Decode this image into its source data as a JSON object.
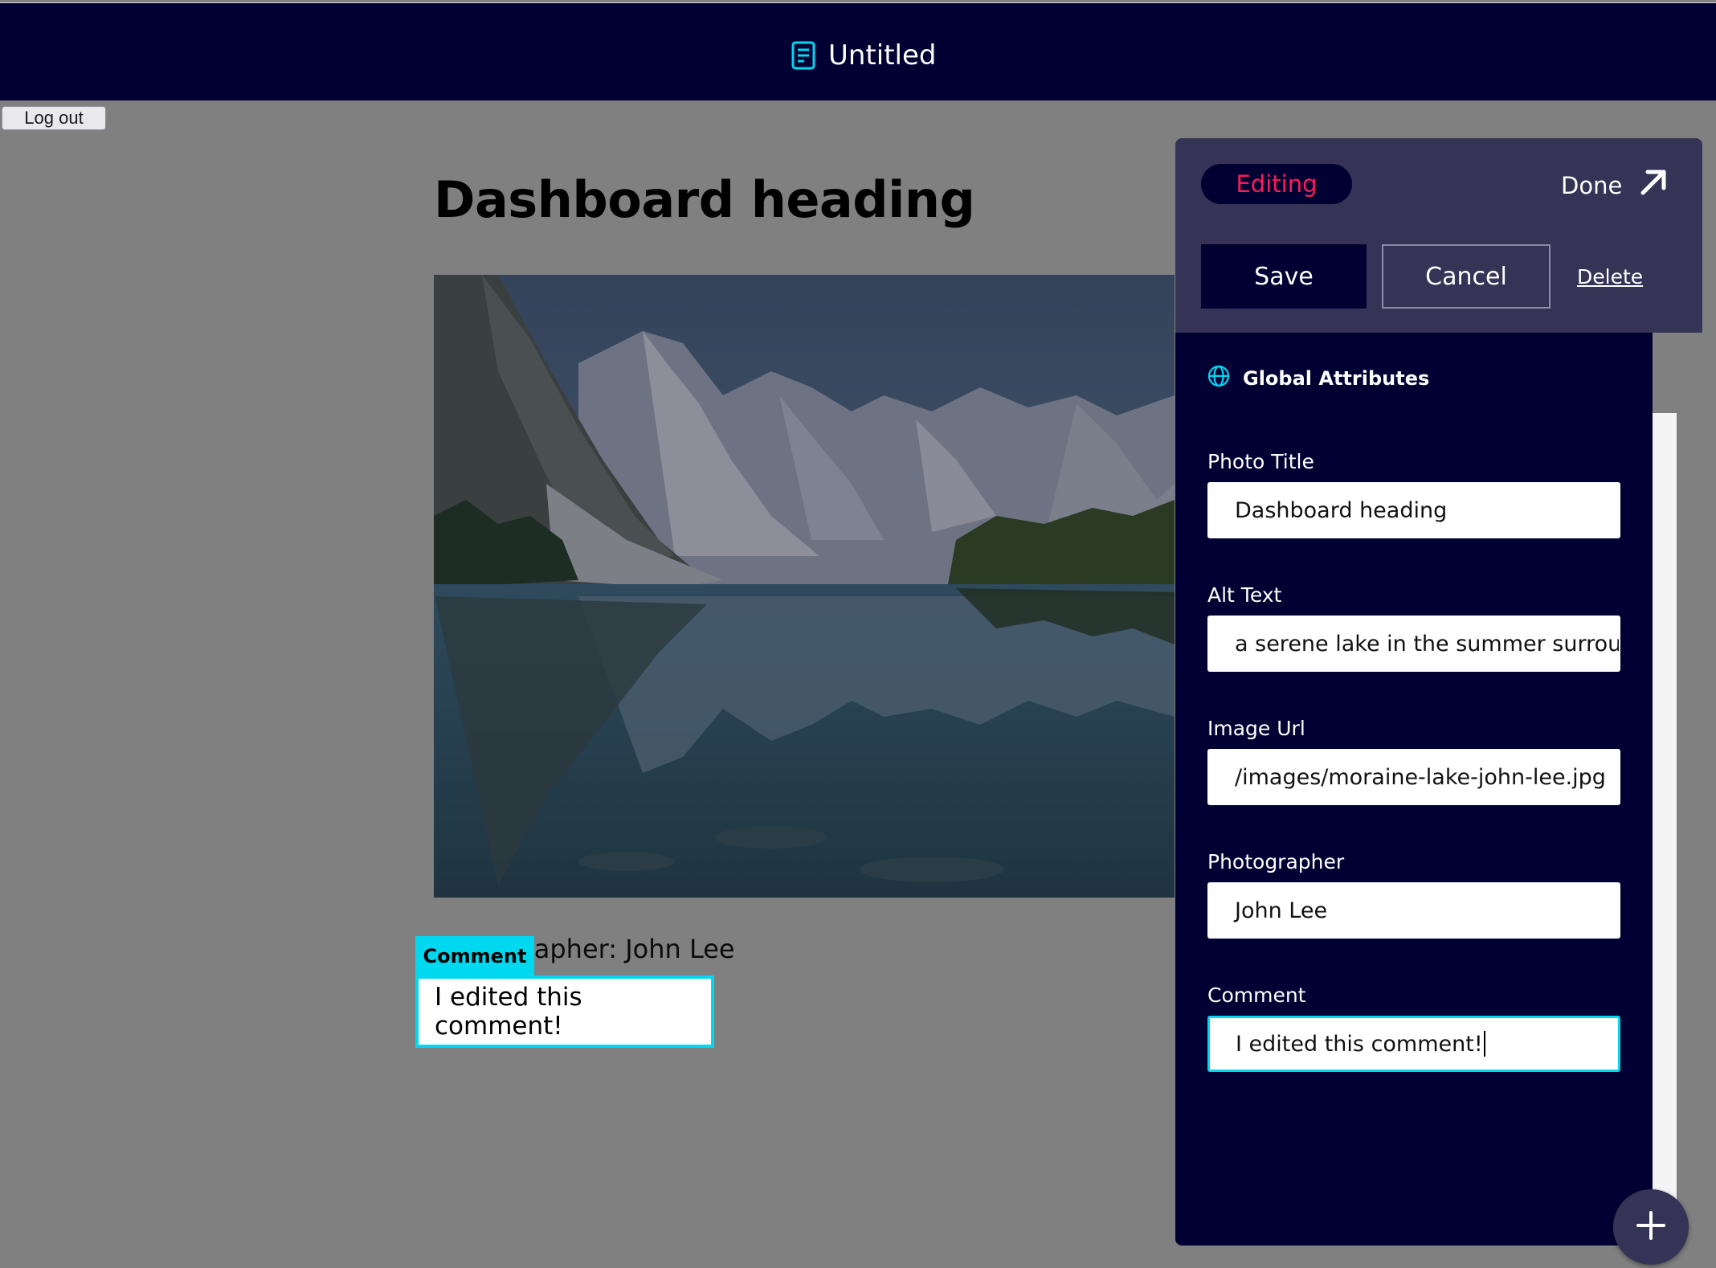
{
  "header": {
    "document_title": "Untitled"
  },
  "auth": {
    "logout_label": "Log out"
  },
  "page": {
    "heading": "Dashboard heading",
    "photographer_line": "Photographer: John Lee",
    "comment_tag": "Comment",
    "comment_text": "I edited this comment!"
  },
  "editor": {
    "status": "Editing",
    "done_label": "Done",
    "save_label": "Save",
    "cancel_label": "Cancel",
    "delete_label": "Delete",
    "section_title": "Global Attributes",
    "fields": [
      {
        "label": "Photo Title",
        "value": "Dashboard heading"
      },
      {
        "label": "Alt Text",
        "value": "a serene lake in the summer surrou"
      },
      {
        "label": "Image Url",
        "value": "/images/moraine-lake-john-lee.jpg"
      },
      {
        "label": "Photographer",
        "value": "John Lee"
      },
      {
        "label": "Comment",
        "value": "I edited this comment!"
      }
    ]
  },
  "colors": {
    "navy": "#000033",
    "panel_purple": "#363456",
    "accent_cyan": "#00d8f0",
    "editing_pink": "#ff1a55",
    "overlay_gray": "#808080"
  },
  "icons": [
    "document-icon",
    "arrow-up-right-icon",
    "globe-icon",
    "plus-icon"
  ]
}
